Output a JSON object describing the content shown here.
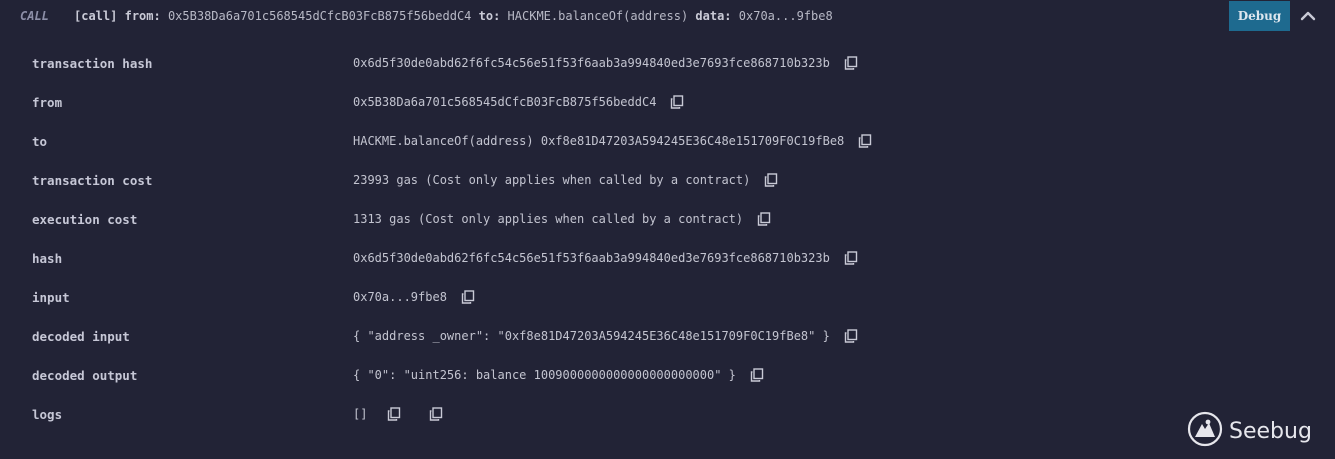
{
  "header": {
    "call_tag": "CALL",
    "call_type": "[call]",
    "from_label": "from:",
    "from_value": "0x5B38Da6a701c568545dCfcB03FcB875f56beddC4",
    "to_label": "to:",
    "to_value": "HACKME.balanceOf(address)",
    "data_label": "data:",
    "data_value": "0x70a...9fbe8",
    "debug_label": "Debug"
  },
  "rows": [
    {
      "label": "transaction hash",
      "value": "0x6d5f30de0abd62f6fc54c56e51f53f6aab3a994840ed3e7693fce868710b323b"
    },
    {
      "label": "from",
      "value": "0x5B38Da6a701c568545dCfcB03FcB875f56beddC4"
    },
    {
      "label": "to",
      "value": "HACKME.balanceOf(address) 0xf8e81D47203A594245E36C48e151709F0C19fBe8"
    },
    {
      "label": "transaction cost",
      "value": "23993 gas (Cost only applies when called by a contract)"
    },
    {
      "label": "execution cost",
      "value": "1313 gas (Cost only applies when called by a contract)"
    },
    {
      "label": "hash",
      "value": "0x6d5f30de0abd62f6fc54c56e51f53f6aab3a994840ed3e7693fce868710b323b"
    },
    {
      "label": "input",
      "value": "0x70a...9fbe8"
    },
    {
      "label": "decoded input",
      "value": "{ \"address _owner\": \"0xf8e81D47203A594245E36C48e151709F0C19fBe8\" }"
    },
    {
      "label": "decoded output",
      "value": "{ \"0\": \"uint256: balance 1009000000000000000000000\" }"
    },
    {
      "label": "logs",
      "value": "[]"
    }
  ],
  "watermark": {
    "brand": "Seebug"
  },
  "icons": {
    "copy": "copy-icon",
    "chevron": "chevron-up-icon"
  },
  "colors": {
    "background": "#222336",
    "debug_button": "#1e6a8f"
  }
}
